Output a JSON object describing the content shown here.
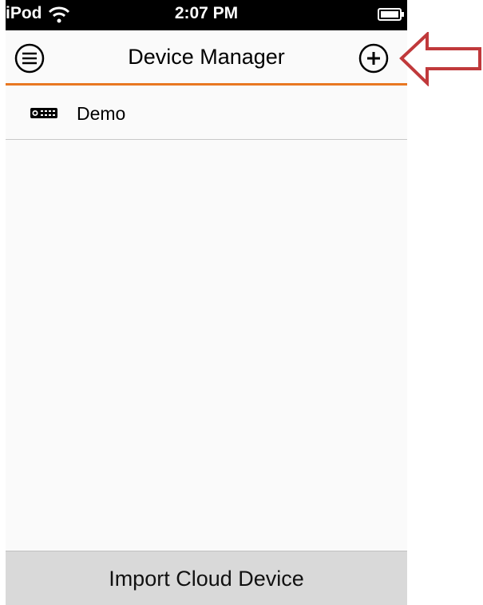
{
  "status_bar": {
    "carrier": "iPod",
    "time": "2:07 PM",
    "wifi_icon": "wifi-icon",
    "battery_icon": "battery-icon"
  },
  "nav": {
    "title": "Device Manager",
    "menu_icon": "menu-icon",
    "add_icon": "add-icon",
    "accent_color": "#e87722"
  },
  "devices": [
    {
      "name": "Demo",
      "icon": "projector-icon"
    }
  ],
  "footer": {
    "import_label": "Import Cloud Device"
  },
  "annotation": {
    "arrow_color": "#c0393b"
  }
}
